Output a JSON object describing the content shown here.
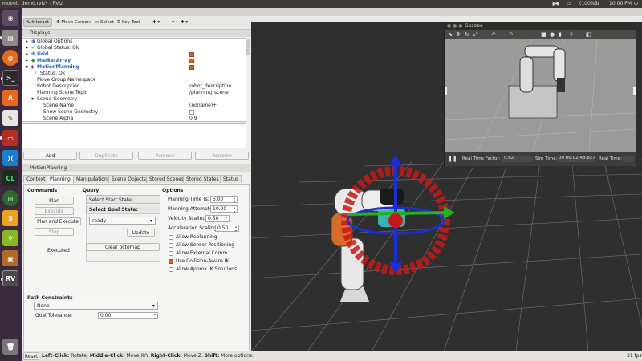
{
  "topbar": {
    "app_title": "moveit_demo.rviz* - RViz",
    "battery": "(100%)",
    "volume": "🔊",
    "time": "10:00 PM"
  },
  "launcher": {
    "items": [
      "dash-icon",
      "files-icon",
      "firefox-icon",
      "terminal-icon",
      "software-icon",
      "editor-icon",
      "terminal2-icon",
      "vscode-icon",
      "clion-icon",
      "globe-icon",
      "sublime-icon",
      "search-app-icon",
      "box-icon",
      "rviz-icon",
      "trash-icon"
    ]
  },
  "toolbar": {
    "interact": "Interact",
    "move_camera": "Move Camera",
    "select": "Select",
    "key_tool": "Key Tool"
  },
  "displays": {
    "header": "Displays",
    "rows": [
      {
        "name": "Global Options",
        "value": ""
      },
      {
        "name": "Global Status: Ok",
        "value": ""
      },
      {
        "name": "Grid",
        "value": ""
      },
      {
        "name": "MarkerArray",
        "value": ""
      },
      {
        "name": "MotionPlanning",
        "value": ""
      },
      {
        "name": "Status: Ok",
        "value": ""
      },
      {
        "name": "Move Group Namespace",
        "value": ""
      },
      {
        "name": "Robot Description",
        "value": "robot_description"
      },
      {
        "name": "Planning Scene Topic",
        "value": "/planning_scene"
      },
      {
        "name": "Scene Geometry",
        "value": ""
      },
      {
        "name": "Scene Name",
        "value": "(noname)+"
      },
      {
        "name": "Show Scene Geometry",
        "value": ""
      },
      {
        "name": "Scene Alpha",
        "value": "0.9"
      }
    ],
    "buttons": {
      "add": "Add",
      "duplicate": "Duplicate",
      "remove": "Remove",
      "rename": "Rename"
    }
  },
  "motion": {
    "header": "MotionPlanning",
    "tabs": [
      "Context",
      "Planning",
      "Manipulation",
      "Scene Objects",
      "Stored Scenes",
      "Stored States",
      "Status"
    ],
    "commands": {
      "title": "Commands",
      "plan": "Plan",
      "execute": "Execute",
      "plan_execute": "Plan and Execute",
      "stop": "Stop",
      "status": "Executed"
    },
    "query": {
      "title": "Query",
      "start": "Select Start State:",
      "goal": "Select Goal State:",
      "goal_value": "ready",
      "update": "Update",
      "clear": "Clear octomap"
    },
    "options": {
      "title": "Options",
      "planning_time_label": "Planning Time (s):",
      "planning_time": "5.00",
      "attempts_label": "Planning Attempts:",
      "attempts": "10.00",
      "velocity_label": "Velocity Scaling:",
      "velocity": "0.50",
      "accel_label": "Acceleration Scaling:",
      "accel": "0.50",
      "checks": [
        {
          "label": "Allow Replanning",
          "on": false
        },
        {
          "label": "Allow Sensor Positioning",
          "on": false
        },
        {
          "label": "Allow External Comm.",
          "on": false
        },
        {
          "label": "Use Collision-Aware IK",
          "on": true
        },
        {
          "label": "Allow Approx IK Solutions",
          "on": false
        }
      ]
    },
    "constraints": {
      "title": "Path Constraints",
      "value": "None",
      "tol_label": "Goal Tolerance:",
      "tol": "0.00"
    }
  },
  "statusbar": {
    "reset": "Reset",
    "left_click": "Left-Click:",
    "left_click_desc": "Rotate.",
    "middle_click": "Middle-Click:",
    "middle_click_desc": "Move X/Y.",
    "right_click": "Right-Click:",
    "right_click_desc": "Move Z.",
    "shift": "Shift:",
    "shift_desc": "More options.",
    "fps": "31 fps"
  },
  "gazebo": {
    "title": "Gazebo",
    "rtf_label": "Real Time Factor:",
    "rtf": "0.62",
    "sim_label": "Sim Time:",
    "sim": "00 00:02:48.827",
    "real_label": "Real Time:"
  }
}
